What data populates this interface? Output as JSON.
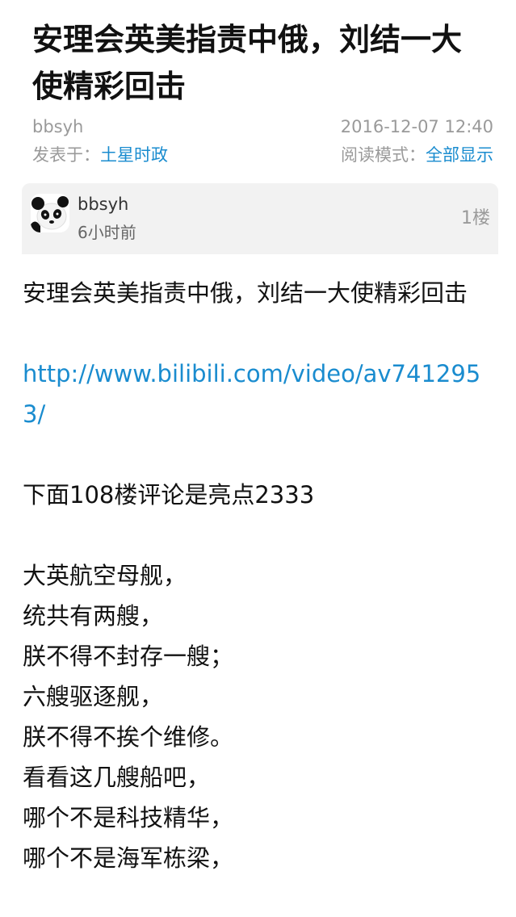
{
  "article": {
    "title": "安理会英美指责中俄，刘结一大使精彩回击",
    "author": "bbsyh",
    "datetime": "2016-12-07 12:40",
    "posted_in_label": "发表于：",
    "forum": "土星时政",
    "read_mode_label": "阅读模式：",
    "read_mode_value": "全部显示"
  },
  "post": {
    "avatar_icon": "panda-avatar-icon",
    "author": "bbsyh",
    "time": "6小时前",
    "floor": "1楼",
    "heading": "安理会英美指责中俄，刘结一大使精彩回击",
    "url": "http://www.bilibili.com/video/av7412953/",
    "highlight": "下面108楼评论是亮点2333",
    "poem": [
      "大英航空母舰，",
      "统共有两艘，",
      "朕不得不封存一艘；",
      "六艘驱逐舰，",
      "朕不得不挨个维修。",
      "看看这几艘船吧，",
      "哪个不是科技精华，",
      "哪个不是海军栋梁，"
    ]
  },
  "colors": {
    "link": "#1a8ccf",
    "meta_gray": "#9a9a9a",
    "header_bg": "#f2f2f2"
  }
}
